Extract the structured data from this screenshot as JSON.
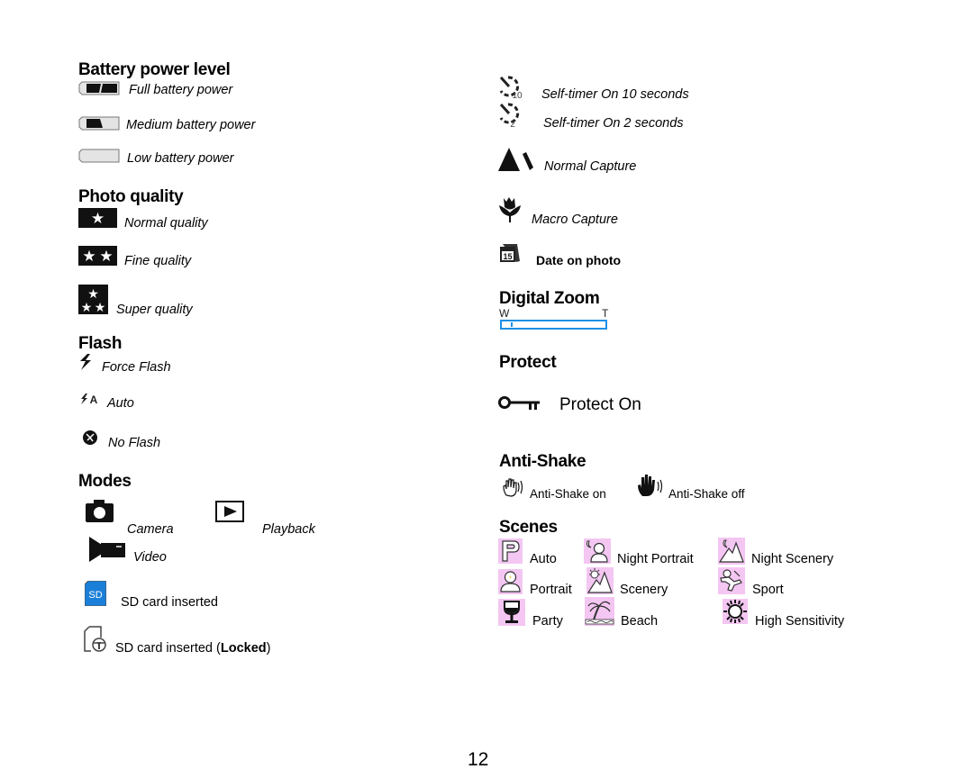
{
  "left_column": {
    "battery": {
      "heading": "Battery power level",
      "items": [
        {
          "icon": "battery-full-icon",
          "label": "Full battery power"
        },
        {
          "icon": "battery-medium-icon",
          "label": "Medium battery power"
        },
        {
          "icon": "battery-low-icon",
          "label": "Low battery power"
        }
      ]
    },
    "quality": {
      "heading": "Photo quality",
      "items": [
        {
          "icon": "one-star-icon",
          "label": "Normal quality"
        },
        {
          "icon": "two-star-icon",
          "label": "Fine quality"
        },
        {
          "icon": "three-star-icon",
          "label": "Super quality"
        }
      ]
    },
    "flash": {
      "heading": "Flash",
      "items": [
        {
          "icon": "force-flash-icon",
          "label": "Force Flash"
        },
        {
          "icon": "auto-flash-icon",
          "label": "Auto"
        },
        {
          "icon": "no-flash-icon",
          "label": "No Flash"
        }
      ]
    },
    "modes": {
      "heading": "Modes",
      "items": [
        {
          "icon": "camera-icon",
          "label": "Camera"
        },
        {
          "icon": "playback-icon",
          "label": "Playback"
        },
        {
          "icon": "video-icon",
          "label": "Video"
        }
      ]
    },
    "sd": {
      "items": [
        {
          "icon": "sd-card-icon",
          "label": "SD card inserted"
        },
        {
          "icon": "sd-card-locked-icon",
          "label_prefix": "SD card inserted (",
          "label_bold": "Locked",
          "label_suffix": ")"
        }
      ],
      "sd_color": "#1a7fd8"
    }
  },
  "right_column": {
    "timer": {
      "items": [
        {
          "icon": "self-timer-10-icon",
          "icon_number": "10",
          "label": "Self-timer On 10 seconds"
        },
        {
          "icon": "self-timer-2-icon",
          "icon_number": "2",
          "label": "Self-timer On 2 seconds"
        }
      ]
    },
    "capture": {
      "items": [
        {
          "icon": "normal-capture-icon",
          "label": "Normal Capture"
        },
        {
          "icon": "macro-capture-icon",
          "label": "Macro Capture"
        },
        {
          "icon": "date-stamp-icon",
          "icon_number": "15",
          "label": "Date on photo"
        }
      ]
    },
    "zoom": {
      "heading": "Digital Zoom",
      "wide_label": "W",
      "tele_label": "T",
      "zoom_level_fraction": 0.08,
      "bar_color": "#1e90e6"
    },
    "protect": {
      "heading": "Protect",
      "label": "Protect On"
    },
    "antishake": {
      "heading": "Anti-Shake",
      "on_label": "Anti-Shake on",
      "off_label": "Anti-Shake off"
    },
    "scenes": {
      "heading": "Scenes",
      "icon_bg": "#f4c6f2",
      "items": [
        {
          "icon": "scene-auto-icon",
          "label": "Auto"
        },
        {
          "icon": "scene-night-portrait-icon",
          "label": "Night Portrait"
        },
        {
          "icon": "scene-night-scenery-icon",
          "label": "Night Scenery"
        },
        {
          "icon": "scene-portrait-icon",
          "label": "Portrait"
        },
        {
          "icon": "scene-scenery-icon",
          "label": "Scenery"
        },
        {
          "icon": "scene-sport-icon",
          "label": "Sport"
        },
        {
          "icon": "scene-party-icon",
          "label": "Party"
        },
        {
          "icon": "scene-beach-icon",
          "label": "Beach"
        },
        {
          "icon": "scene-high-sensitivity-icon",
          "label": "High Sensitivity"
        }
      ]
    }
  },
  "page_number": "12"
}
